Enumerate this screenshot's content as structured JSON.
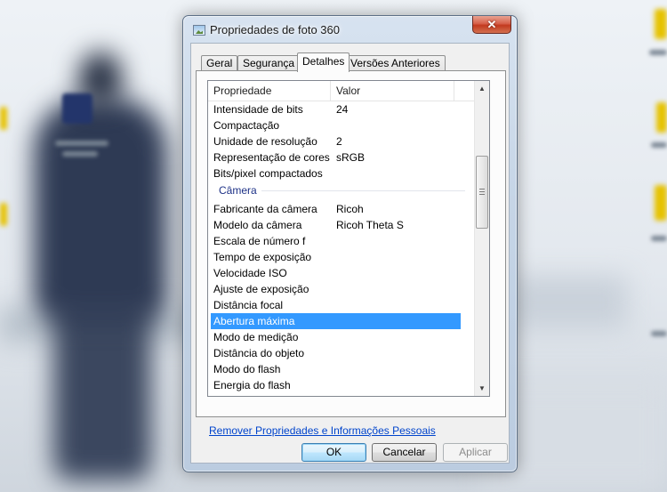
{
  "window": {
    "title": "Propriedades de foto 360",
    "close_label": "✕"
  },
  "tabs": [
    {
      "label": "Geral",
      "active": false
    },
    {
      "label": "Segurança",
      "active": false
    },
    {
      "label": "Detalhes",
      "active": true
    },
    {
      "label": "Versões Anteriores",
      "active": false
    }
  ],
  "details": {
    "columns": {
      "property": "Propriedade",
      "value": "Valor"
    },
    "rows_top": [
      {
        "property": "Intensidade de bits",
        "value": "24"
      },
      {
        "property": "Compactação",
        "value": ""
      },
      {
        "property": "Unidade de resolução",
        "value": "2"
      },
      {
        "property": "Representação de cores",
        "value": "sRGB"
      },
      {
        "property": "Bits/pixel compactados",
        "value": ""
      }
    ],
    "group_camera": "Câmera",
    "rows_camera": [
      {
        "property": "Fabricante da câmera",
        "value": "Ricoh"
      },
      {
        "property": "Modelo da câmera",
        "value": "Ricoh Theta S"
      },
      {
        "property": "Escala de número f",
        "value": ""
      },
      {
        "property": "Tempo de exposição",
        "value": ""
      },
      {
        "property": "Velocidade ISO",
        "value": ""
      },
      {
        "property": "Ajuste de exposição",
        "value": ""
      },
      {
        "property": "Distância focal",
        "value": ""
      },
      {
        "property": "Abertura máxima",
        "value": "",
        "selected": true
      },
      {
        "property": "Modo de medição",
        "value": ""
      },
      {
        "property": "Distância do objeto",
        "value": ""
      },
      {
        "property": "Modo do flash",
        "value": ""
      },
      {
        "property": "Energia do flash",
        "value": ""
      }
    ]
  },
  "remove_link": "Remover Propriedades e Informações Pessoais",
  "buttons": {
    "ok": "OK",
    "cancel": "Cancelar",
    "apply": "Aplicar"
  },
  "colors": {
    "selection": "#3399ff",
    "link": "#0044cc",
    "group_header": "#1e3287"
  }
}
